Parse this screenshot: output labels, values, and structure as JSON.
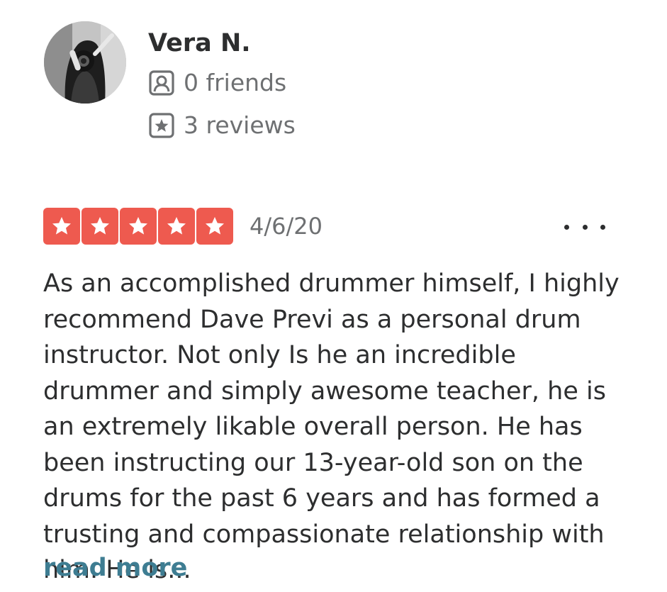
{
  "user": {
    "name": "Vera N.",
    "avatar_icon": "user-photo-avatar",
    "friends_text": "0 friends",
    "friends_icon": "friends-icon",
    "reviews_text": "3 reviews",
    "reviews_icon": "reviews-icon"
  },
  "review": {
    "rating": 5,
    "rating_max": 5,
    "star_color": "#ee5a4f",
    "date": "4/6/20",
    "more_icon": "more-options-icon",
    "text": "As an accomplished drummer himself, I highly recommend Dave Previ as a personal drum instructor. Not only Is he an incredible drummer and simply awesome teacher, he is an extremely likable overall person. He has been instructing our 13-year-old son on the drums for the past 6 years and has formed a trusting and compassionate relationship with him. He is...",
    "read_more_label": "read more",
    "link_color": "#3e7d92"
  }
}
